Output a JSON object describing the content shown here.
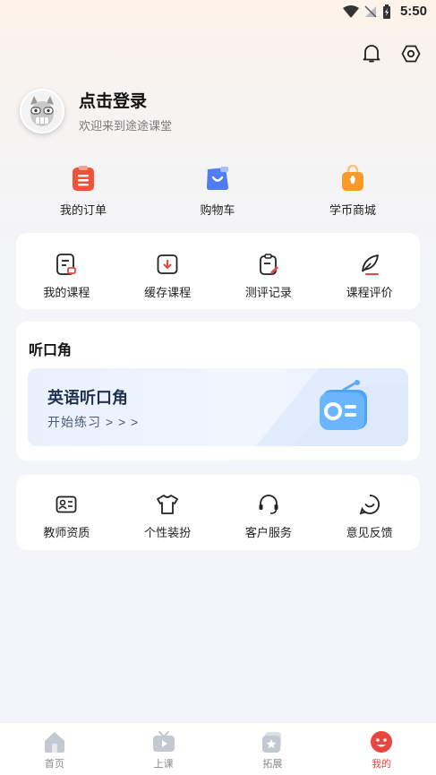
{
  "status": {
    "time": "5:50"
  },
  "profile": {
    "title": "点击登录",
    "subtitle": "欢迎来到途途课堂"
  },
  "quick": [
    {
      "label": "我的订单",
      "icon": "order-icon",
      "color": "#f0523a"
    },
    {
      "label": "购物车",
      "icon": "cart-icon",
      "color": "#4e7cf2"
    },
    {
      "label": "学币商城",
      "icon": "shop-bag-icon",
      "color": "#f79a2a"
    }
  ],
  "courses": [
    {
      "label": "我的课程",
      "icon": "my-course-icon"
    },
    {
      "label": "缓存课程",
      "icon": "download-course-icon"
    },
    {
      "label": "测评记录",
      "icon": "assessment-icon"
    },
    {
      "label": "课程评价",
      "icon": "feather-icon"
    }
  ],
  "listen": {
    "title": "听口角",
    "banner_title": "英语听口角",
    "banner_sub": "开始练习 > > >"
  },
  "services": [
    {
      "label": "教师资质",
      "icon": "id-card-icon"
    },
    {
      "label": "个性装扮",
      "icon": "tshirt-icon"
    },
    {
      "label": "客户服务",
      "icon": "headset-icon"
    },
    {
      "label": "意见反馈",
      "icon": "smile-icon"
    }
  ],
  "tabs": [
    {
      "label": "首页",
      "icon": "home-icon"
    },
    {
      "label": "上课",
      "icon": "tv-icon"
    },
    {
      "label": "拓展",
      "icon": "star-card-icon"
    },
    {
      "label": "我的",
      "icon": "mine-face-icon"
    }
  ],
  "colors": {
    "accent": "#e8463f",
    "tab_inactive": "#c4c8d0"
  }
}
